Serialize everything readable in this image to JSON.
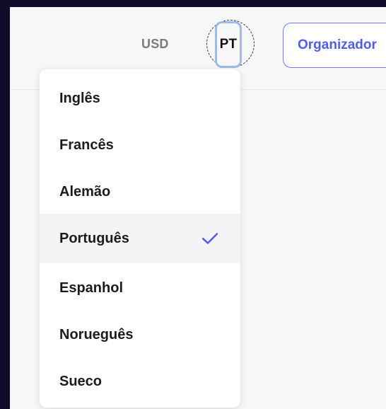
{
  "header": {
    "currency": "USD",
    "language_short": "PT",
    "organizer_button": "Organizador"
  },
  "language_menu": {
    "items": [
      {
        "label": "Inglês"
      },
      {
        "label": "Francês"
      },
      {
        "label": "Alemão"
      },
      {
        "label": "Português",
        "selected": true
      },
      {
        "label": "Espanhol"
      },
      {
        "label": "Norueguês"
      },
      {
        "label": "Sueco"
      }
    ],
    "check_icon": "checkmark-icon"
  },
  "colors": {
    "accent": "#4e5fe8",
    "focus_ring": "#9bbbe8",
    "outer_bg": "#0e0c2a"
  }
}
